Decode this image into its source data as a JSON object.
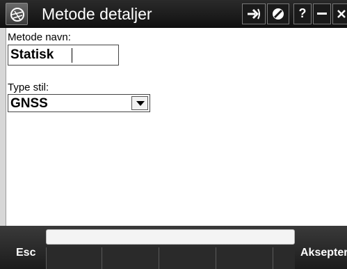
{
  "window": {
    "title": "Metode detaljer",
    "app_icon": "trimble-logo-icon"
  },
  "titlebar_buttons": [
    {
      "name": "forward-button",
      "icon": "arrow-right-icon"
    },
    {
      "name": "block-button",
      "icon": "no-entry-icon"
    },
    {
      "name": "help-button",
      "label": "?"
    },
    {
      "name": "minimize-button",
      "icon": "minus-icon"
    },
    {
      "name": "close-button",
      "icon": "close-icon"
    }
  ],
  "form": {
    "method_name_label": "Metode navn:",
    "method_name_value": "Statisk",
    "style_type_label": "Type stil:",
    "style_type_value": "GNSS"
  },
  "softkeys": {
    "esc": "Esc",
    "accept": "Aksepter"
  },
  "colors": {
    "titlebar": "#1a1a1a",
    "softkey_bar": "#2a2a2a",
    "text": "#000000",
    "background": "#ffffff"
  }
}
